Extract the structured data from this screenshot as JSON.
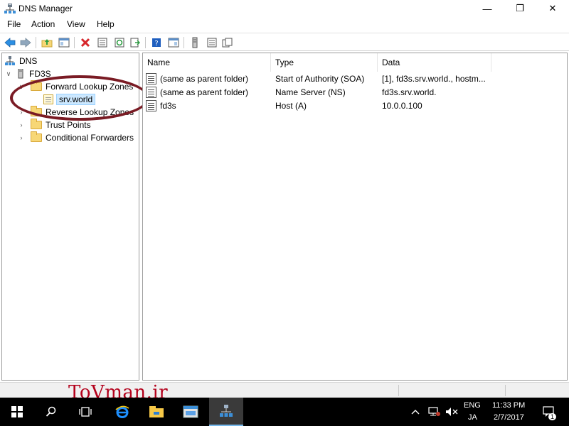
{
  "window": {
    "title": "DNS Manager",
    "controls": {
      "minimize": "—",
      "maximize": "❐",
      "close": "✕"
    }
  },
  "menu": {
    "items": [
      "File",
      "Action",
      "View",
      "Help"
    ]
  },
  "toolbar": {
    "buttons": [
      "back-arrow-icon",
      "forward-arrow-icon",
      "up-folder-icon",
      "show-hide-tree-icon",
      "delete-icon",
      "properties-icon",
      "refresh-icon",
      "export-list-icon",
      "help-icon",
      "show-hide-action-pane-icon",
      "server-icon",
      "list-view-icon",
      "copy-icon"
    ]
  },
  "tree": {
    "root": "DNS",
    "server": "FD3S",
    "forward_lookup_zones": "Forward Lookup Zones",
    "selected_zone": "srv.world",
    "reverse_lookup_zones": "Reverse Lookup Zones",
    "trust_points": "Trust Points",
    "conditional_forwarders": "Conditional Forwarders"
  },
  "list": {
    "columns": [
      "Name",
      "Type",
      "Data"
    ],
    "rows": [
      {
        "name": "(same as parent folder)",
        "type": "Start of Authority (SOA)",
        "data": "[1], fd3s.srv.world., hostm..."
      },
      {
        "name": "(same as parent folder)",
        "type": "Name Server (NS)",
        "data": "fd3s.srv.world."
      },
      {
        "name": "fd3s",
        "type": "Host (A)",
        "data": "10.0.0.100"
      }
    ]
  },
  "watermark": "ToVman.ir",
  "taskbar": {
    "language_line1": "ENG",
    "language_line2": "JA",
    "time": "11:33 PM",
    "date": "2/7/2017",
    "notification_count": "1"
  },
  "colors": {
    "annotation": "#7a1b24",
    "selection": "#cce8ff",
    "watermark": "#b3001b",
    "taskbar": "#000000"
  }
}
